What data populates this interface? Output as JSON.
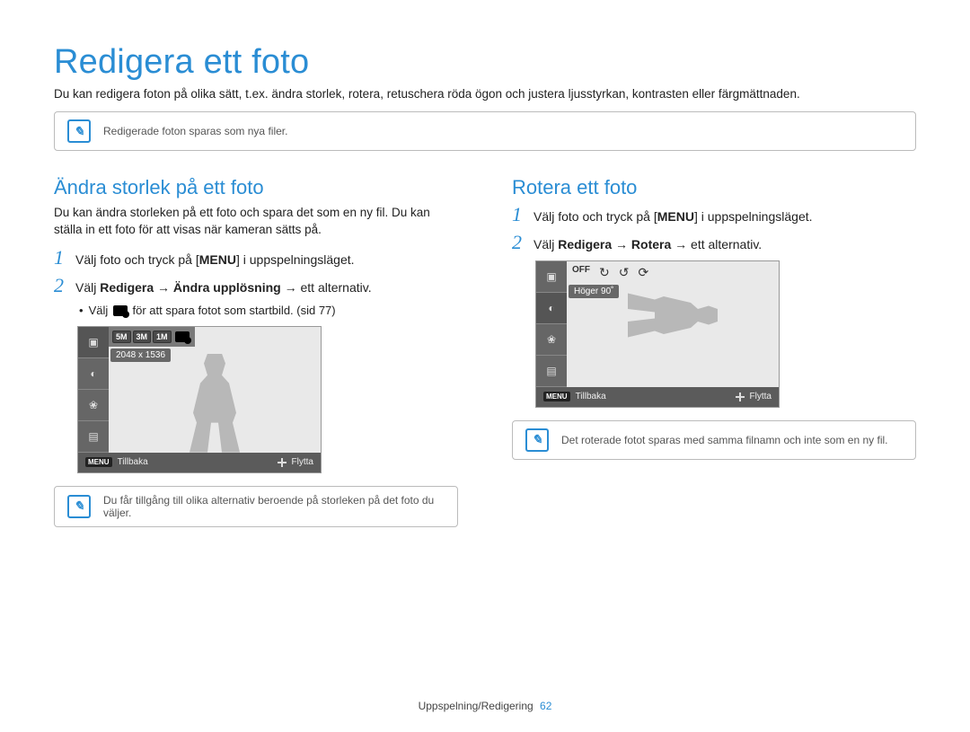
{
  "page": {
    "title": "Redigera ett foto",
    "intro": "Du kan redigera foton på olika sätt, t.ex. ändra storlek, rotera, retuschera röda ögon och justera ljusstyrkan, kontrasten eller färgmättnaden.",
    "top_note": "Redigerade foton sparas som nya filer."
  },
  "left": {
    "title": "Ändra storlek på ett foto",
    "desc": "Du kan ändra storleken på ett foto och spara det som en ny fil. Du kan ställa in ett foto för att visas när kameran sätts på.",
    "step1_pre": "Välj foto och tryck på [",
    "menu": "MENU",
    "step1_post": "] i uppspelningsläget.",
    "step2_pre": "Välj ",
    "step2_bold": "Redigera → Ändra upplösning",
    "step2_post": " → ett alternativ.",
    "bullet_pre": "Välj ",
    "bullet_post": " för att spara fotot som startbild. (sid 77)",
    "lcd": {
      "chips": [
        "5M",
        "3M",
        "1M"
      ],
      "tooltip": "2048 x 1536",
      "back_btn": "MENU",
      "back": "Tillbaka",
      "move": "Flytta"
    },
    "note": "Du får tillgång till olika alternativ beroende på storleken på det foto du väljer."
  },
  "right": {
    "title": "Rotera ett foto",
    "step1_pre": "Välj foto och tryck på [",
    "menu": "MENU",
    "step1_post": "] i uppspelningsläget.",
    "step2_pre": "Välj ",
    "step2_bold": "Redigera → Rotera",
    "step2_post": " → ett alternativ.",
    "lcd": {
      "tooltip": "Höger 90˚",
      "back_btn": "MENU",
      "back": "Tillbaka",
      "move": "Flytta"
    },
    "note": "Det roterade fotot sparas med samma filnamn och inte som en ny fil."
  },
  "footer": {
    "section": "Uppspelning/Redigering",
    "page": "62"
  }
}
